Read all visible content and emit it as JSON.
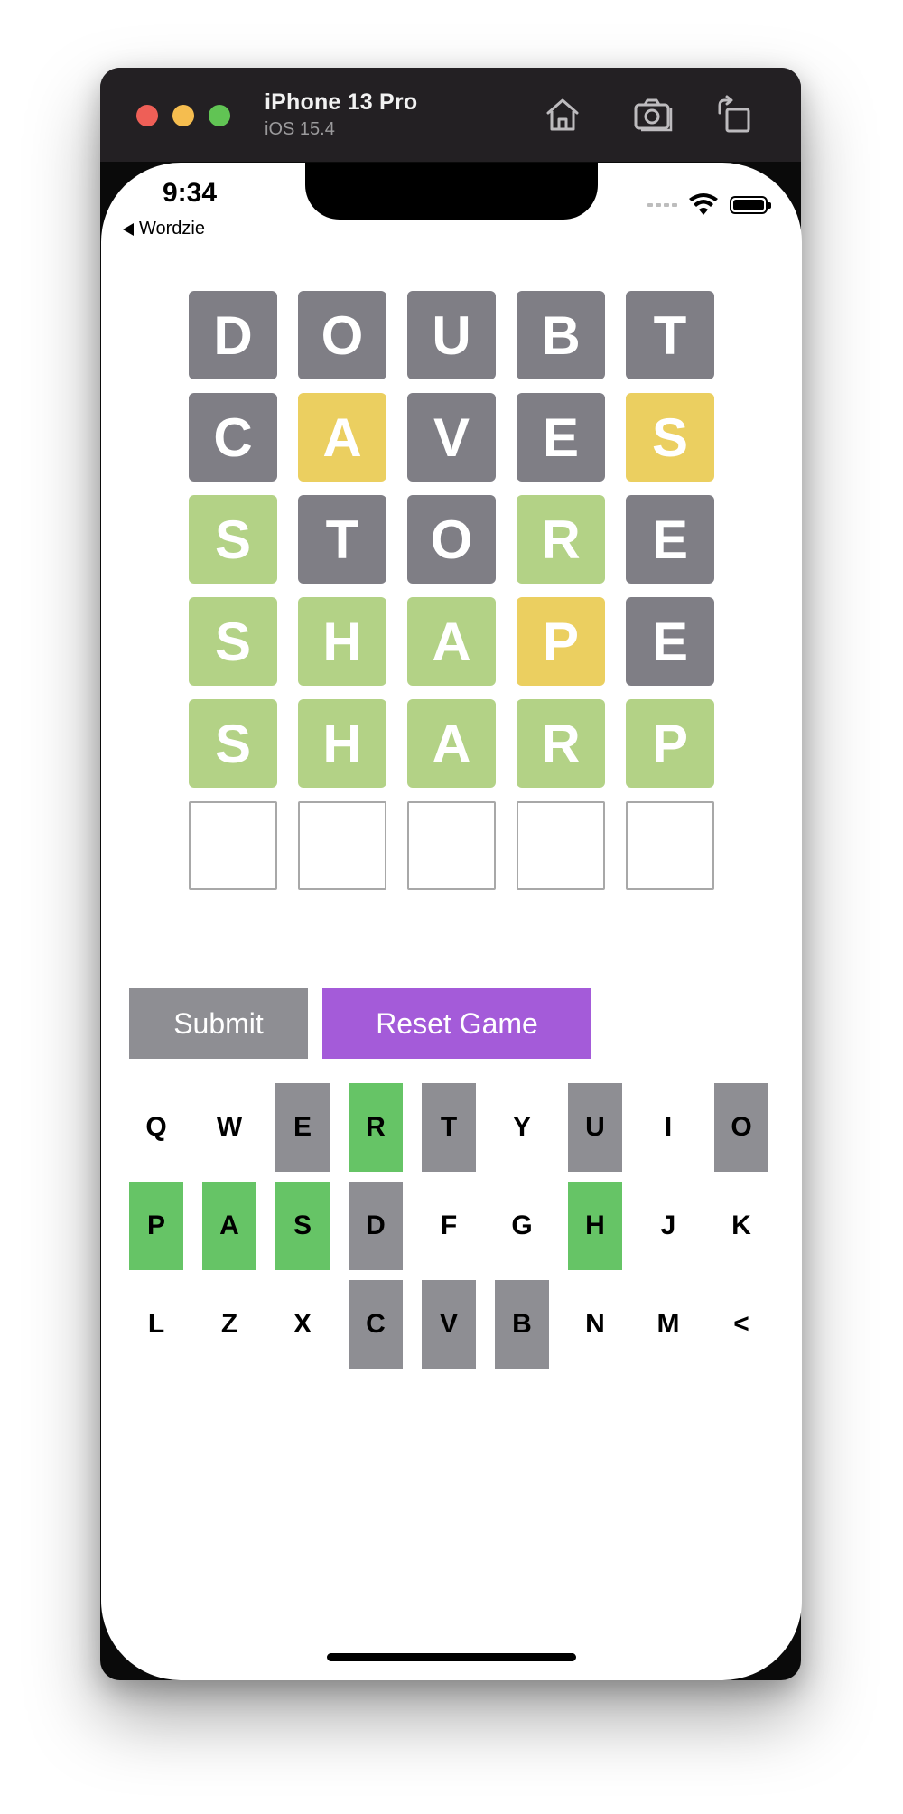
{
  "simulator": {
    "device_name": "iPhone 13 Pro",
    "os_version": "iOS 15.4",
    "icons": [
      "home-icon",
      "screenshot-icon",
      "rotate-icon"
    ]
  },
  "status_bar": {
    "time": "9:34",
    "back_label": "Wordzie"
  },
  "board": {
    "rows": [
      [
        {
          "l": "D",
          "s": "gray"
        },
        {
          "l": "O",
          "s": "gray"
        },
        {
          "l": "U",
          "s": "gray"
        },
        {
          "l": "B",
          "s": "gray"
        },
        {
          "l": "T",
          "s": "gray"
        }
      ],
      [
        {
          "l": "C",
          "s": "gray"
        },
        {
          "l": "A",
          "s": "yellow"
        },
        {
          "l": "V",
          "s": "gray"
        },
        {
          "l": "E",
          "s": "gray"
        },
        {
          "l": "S",
          "s": "yellow"
        }
      ],
      [
        {
          "l": "S",
          "s": "green"
        },
        {
          "l": "T",
          "s": "gray"
        },
        {
          "l": "O",
          "s": "gray"
        },
        {
          "l": "R",
          "s": "green"
        },
        {
          "l": "E",
          "s": "gray"
        }
      ],
      [
        {
          "l": "S",
          "s": "green"
        },
        {
          "l": "H",
          "s": "green"
        },
        {
          "l": "A",
          "s": "green"
        },
        {
          "l": "P",
          "s": "yellow"
        },
        {
          "l": "E",
          "s": "gray"
        }
      ],
      [
        {
          "l": "S",
          "s": "green"
        },
        {
          "l": "H",
          "s": "green"
        },
        {
          "l": "A",
          "s": "green"
        },
        {
          "l": "R",
          "s": "green"
        },
        {
          "l": "P",
          "s": "green"
        }
      ],
      [
        {
          "l": "",
          "s": "empty"
        },
        {
          "l": "",
          "s": "empty"
        },
        {
          "l": "",
          "s": "empty"
        },
        {
          "l": "",
          "s": "empty"
        },
        {
          "l": "",
          "s": "empty"
        }
      ]
    ]
  },
  "buttons": {
    "submit_label": "Submit",
    "reset_label": "Reset Game"
  },
  "keyboard": {
    "rows": [
      [
        {
          "k": "Q",
          "s": "none"
        },
        {
          "k": "W",
          "s": "none"
        },
        {
          "k": "E",
          "s": "gray"
        },
        {
          "k": "R",
          "s": "green"
        },
        {
          "k": "T",
          "s": "gray"
        },
        {
          "k": "Y",
          "s": "none"
        },
        {
          "k": "U",
          "s": "gray"
        },
        {
          "k": "I",
          "s": "none"
        },
        {
          "k": "O",
          "s": "gray"
        }
      ],
      [
        {
          "k": "P",
          "s": "green"
        },
        {
          "k": "A",
          "s": "green"
        },
        {
          "k": "S",
          "s": "green"
        },
        {
          "k": "D",
          "s": "gray"
        },
        {
          "k": "F",
          "s": "none"
        },
        {
          "k": "G",
          "s": "none"
        },
        {
          "k": "H",
          "s": "green"
        },
        {
          "k": "J",
          "s": "none"
        },
        {
          "k": "K",
          "s": "none"
        }
      ],
      [
        {
          "k": "L",
          "s": "none"
        },
        {
          "k": "Z",
          "s": "none"
        },
        {
          "k": "X",
          "s": "none"
        },
        {
          "k": "C",
          "s": "gray"
        },
        {
          "k": "V",
          "s": "gray"
        },
        {
          "k": "B",
          "s": "gray"
        },
        {
          "k": "N",
          "s": "none"
        },
        {
          "k": "M",
          "s": "none"
        },
        {
          "k": "<",
          "s": "none"
        }
      ]
    ]
  },
  "colors": {
    "tile_gray": "#7f7e85",
    "tile_yellow": "#ebcf60",
    "tile_green": "#b3d286",
    "key_gray": "#8e8e93",
    "key_green": "#66c466",
    "reset_purple": "#a45bd9",
    "submit_gray": "#8e8e93"
  }
}
